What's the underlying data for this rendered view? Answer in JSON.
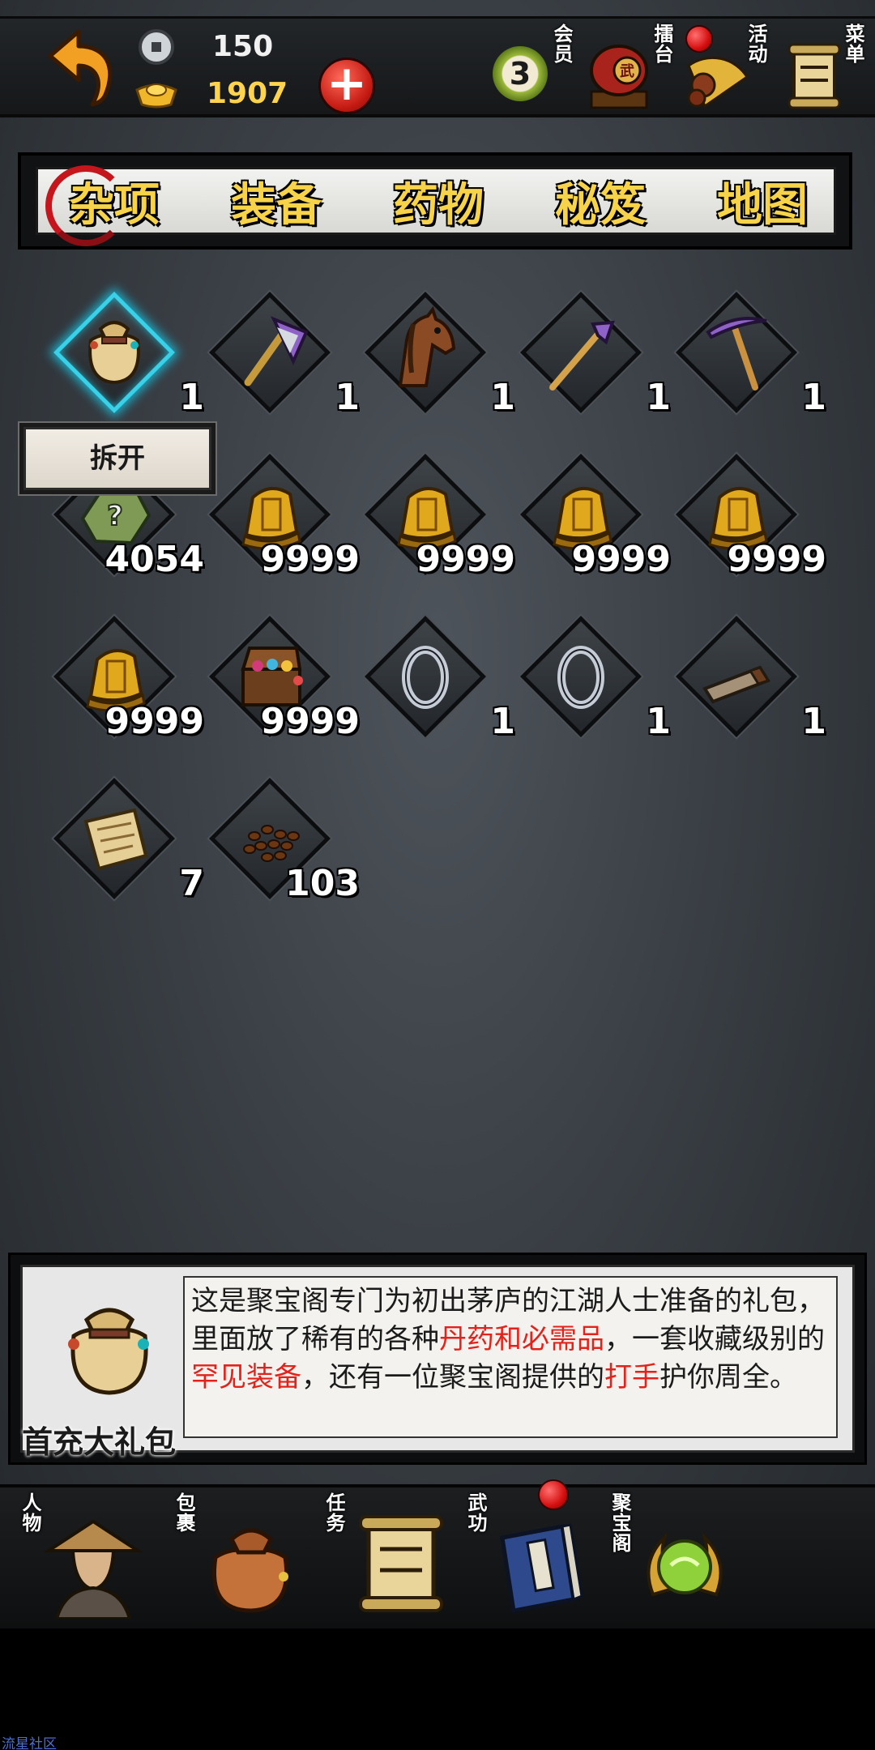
{
  "header": {
    "silver_amount": "150",
    "gold_amount": "1907",
    "add_label": "+",
    "vip_level": "3",
    "vip_label": "会员",
    "arena_label": "擂台",
    "event_label": "活动",
    "menu_label": "菜单"
  },
  "tabs": {
    "items": [
      "杂项",
      "装备",
      "药物",
      "秘笈",
      "地图"
    ],
    "selected": "杂项"
  },
  "inventory": {
    "items": [
      {
        "icon": "gift-bag-icon",
        "qty": "1"
      },
      {
        "icon": "axe-icon",
        "qty": "1"
      },
      {
        "icon": "horse-icon",
        "qty": "1"
      },
      {
        "icon": "hoe-icon",
        "qty": "1"
      },
      {
        "icon": "pickaxe-icon",
        "qty": "1"
      },
      {
        "icon": "mystery-stone-icon",
        "qty": "4054"
      },
      {
        "icon": "token-icon",
        "qty": "9999"
      },
      {
        "icon": "token-icon",
        "qty": "9999"
      },
      {
        "icon": "token-icon",
        "qty": "9999"
      },
      {
        "icon": "token-icon",
        "qty": "9999"
      },
      {
        "icon": "token-icon",
        "qty": "9999"
      },
      {
        "icon": "treasure-chest-icon",
        "qty": "9999"
      },
      {
        "icon": "ring-icon",
        "qty": "1"
      },
      {
        "icon": "ring-icon",
        "qty": "1"
      },
      {
        "icon": "whetstone-icon",
        "qty": "1"
      },
      {
        "icon": "parchment-icon",
        "qty": "7"
      },
      {
        "icon": "beans-icon",
        "qty": "103"
      }
    ],
    "split_button": "拆开"
  },
  "description": {
    "item_name": "首充大礼包",
    "text_1": "这是聚宝阁专门为初出茅庐的江湖人士准备的礼包，里面放了稀有的各种",
    "text_red_1": "丹药和必需品",
    "text_2": "，一套收藏级别的",
    "text_red_2": "罕见装备",
    "text_3": "，还有一位聚宝阁提供的",
    "text_red_3": "打手",
    "text_4": "护你周全。"
  },
  "bottom_nav": {
    "items": [
      "人物",
      "包裹",
      "任务",
      "武功",
      "聚宝阁"
    ]
  },
  "colors": {
    "accent_gold": "#f7d34a",
    "accent_red": "#e3231b",
    "selection_cyan": "#38d1e8"
  },
  "watermark": "流星社区"
}
